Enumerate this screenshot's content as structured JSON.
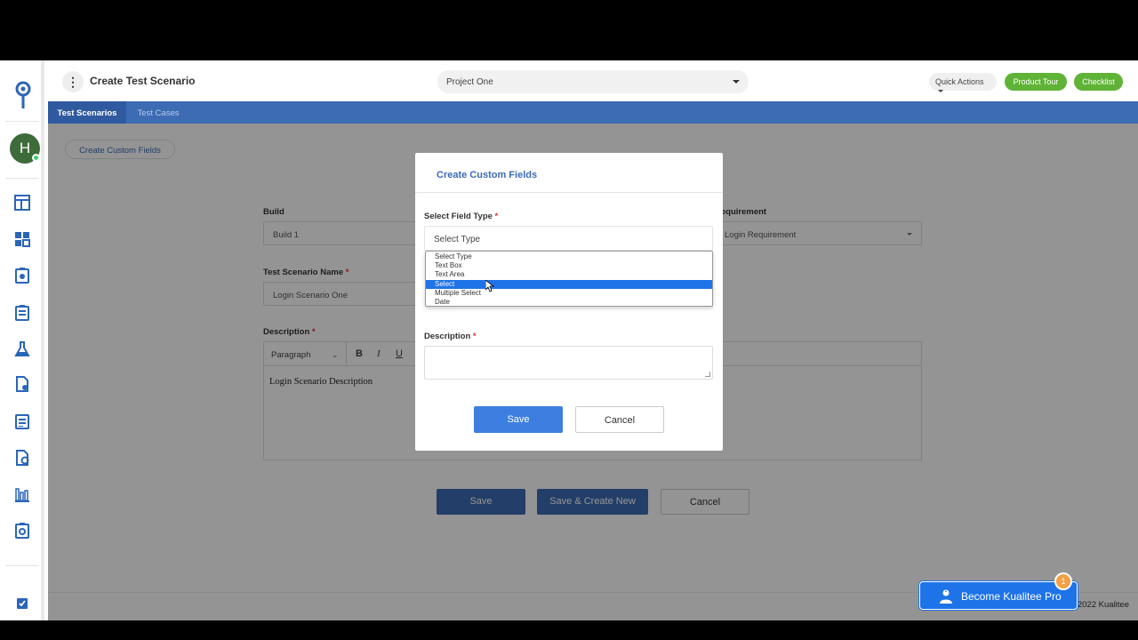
{
  "app": {
    "page_title": "Create Test Scenario",
    "brand_color": "#3d6bb4",
    "green": "#5fb336",
    "avatar_initial": "H"
  },
  "topbar": {
    "project": "Project One",
    "quick_actions": "Quick Actions",
    "product_tour": "Product Tour",
    "checklist": "Checklist"
  },
  "tabs": {
    "test_scenarios": "Test Scenarios",
    "test_cases": "Test Cases"
  },
  "content": {
    "create_custom_fields_btn": "Create Custom Fields",
    "build_label": "Build",
    "build_value": "Build 1",
    "requirement_label": "Requirement",
    "requirement_value": "Login Requirement",
    "scenario_name_label": "Test Scenario Name",
    "scenario_name_value": "Login Scenario One",
    "description_label": "Description",
    "editor_format": "Paragraph",
    "editor_bold": "B",
    "editor_italic": "I",
    "editor_underline": "U",
    "description_value": "Login Scenario Description",
    "save": "Save",
    "save_create_new": "Save & Create New",
    "cancel": "Cancel",
    "copyright": "2022 Kualitee",
    "required_mark": "*"
  },
  "modal": {
    "title": "Create Custom Fields",
    "field_type_label": "Select Field Type",
    "field_type_value": "Select Type",
    "options": [
      "Select Type",
      "Text Box",
      "Text Area",
      "Select",
      "Multiple Select",
      "Date"
    ],
    "selected_option": "Select",
    "description_label": "Description",
    "save": "Save",
    "cancel": "Cancel"
  },
  "promo": {
    "label": "Become Kualitee Pro",
    "badge": "1"
  },
  "icons": [
    "logo-icon",
    "dashboard-icon",
    "widgets-icon",
    "test-scenario-icon",
    "test-case-icon",
    "lab-icon",
    "test-execution-icon",
    "defects-icon",
    "reports-icon",
    "analytics-icon",
    "settings-icon",
    "checklist-icon"
  ]
}
